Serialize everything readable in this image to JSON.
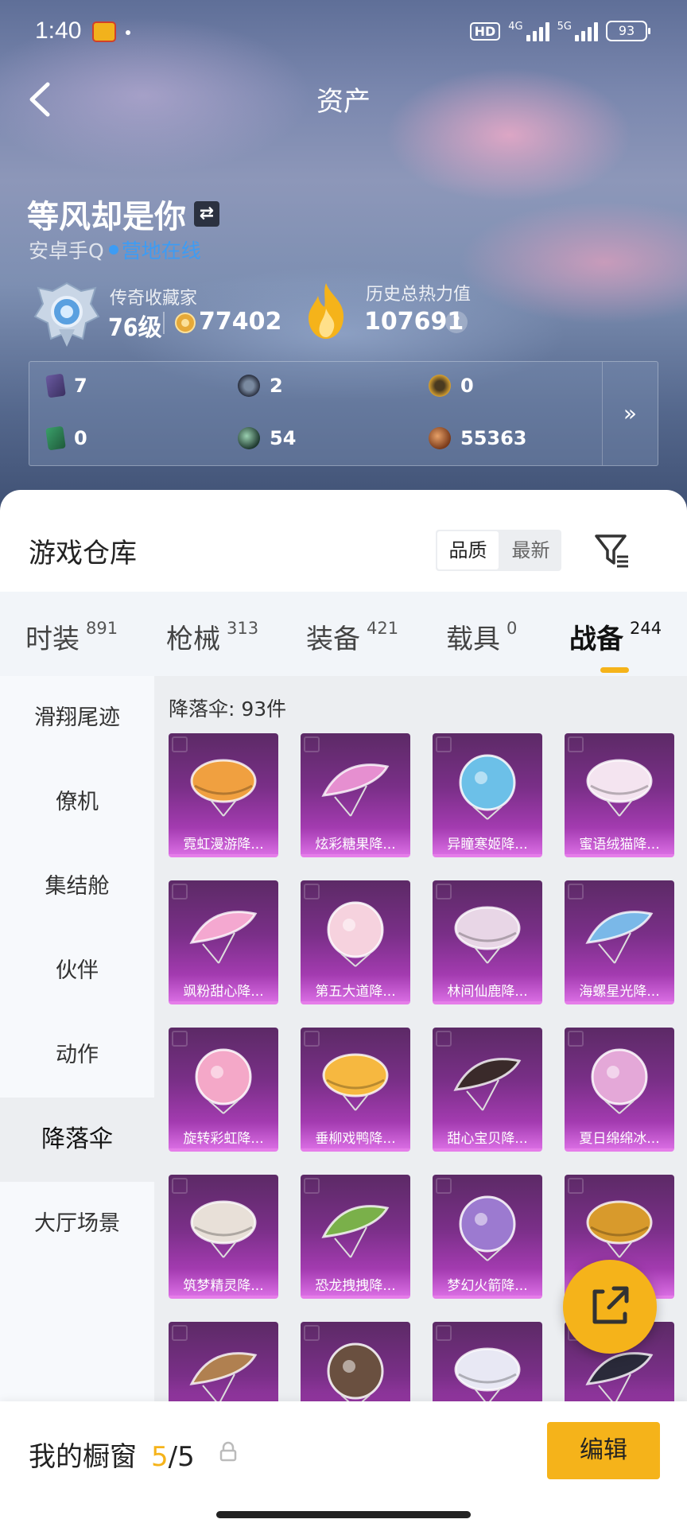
{
  "status_bar": {
    "time": "1:40",
    "hd_label": "HD",
    "net1": "4G",
    "net2": "5G",
    "battery": "93"
  },
  "header": {
    "title": "资产"
  },
  "profile": {
    "username": "等风却是你",
    "account_type": "安卓手Q",
    "online_status": "营地在线",
    "rank_title": "传奇收藏家",
    "level": "76级",
    "coins": "77402",
    "heat_title": "历史总热力值",
    "heat_value": "107691"
  },
  "stats": [
    {
      "icon": "card-icon",
      "value": "7"
    },
    {
      "icon": "round-token-icon",
      "value": "2"
    },
    {
      "icon": "gold-token-icon",
      "value": "0"
    },
    {
      "icon": "green-card-icon",
      "value": "0"
    },
    {
      "icon": "orb-icon",
      "value": "54"
    },
    {
      "icon": "bronze-coin-icon",
      "value": "55363"
    }
  ],
  "warehouse": {
    "title": "游戏仓库",
    "sort_options": [
      "品质",
      "最新"
    ],
    "active_sort": "品质"
  },
  "tabs": [
    {
      "label": "时装",
      "count": "891"
    },
    {
      "label": "枪械",
      "count": "313"
    },
    {
      "label": "装备",
      "count": "421"
    },
    {
      "label": "载具",
      "count": "0"
    },
    {
      "label": "战备",
      "count": "244"
    }
  ],
  "sidebar": {
    "items": [
      "滑翔尾迹",
      "僚机",
      "集结舱",
      "伙伴",
      "动作",
      "降落伞",
      "大厅场景"
    ],
    "active": "降落伞"
  },
  "content": {
    "header": "降落伞: 93件",
    "items": [
      "霓虹漫游降落伞",
      "炫彩糖果降落伞",
      "异瞳寒姬降落伞",
      "蜜语绒猫降落伞",
      "飒粉甜心降落伞",
      "第五大道降落伞",
      "林间仙鹿降落伞",
      "海螺星光降落伞",
      "旋转彩虹降落伞",
      "垂柳戏鸭降落伞",
      "甜心宝贝降落伞",
      "夏日绵绵冰降落伞",
      "筑梦精灵降落伞",
      "恐龙拽拽降落伞",
      "梦幻火箭降落伞",
      "",
      "",
      "",
      "",
      ""
    ],
    "item_labels_shown": [
      "霓虹漫游降...",
      "炫彩糖果降...",
      "异瞳寒姬降...",
      "蜜语绒猫降...",
      "飒粉甜心降...",
      "第五大道降...",
      "林间仙鹿降...",
      "海螺星光降...",
      "旋转彩虹降...",
      "垂柳戏鸭降...",
      "甜心宝贝降...",
      "夏日绵绵冰...",
      "筑梦精灵降...",
      "恐龙拽拽降...",
      "梦幻火箭降...",
      "",
      "",
      "",
      "",
      ""
    ],
    "art_colors": [
      "#f0a040",
      "#e68fd0",
      "#6cc0e8",
      "#f4e4f0",
      "#f4a8d0",
      "#f6d2de",
      "#e8d6e6",
      "#7ab8e8",
      "#f4a8c8",
      "#f6b840",
      "#3a2a2a",
      "#e4a8d8",
      "#e8e0d8",
      "#7ab04a",
      "#9c7ad0",
      "#d89a2c",
      "#b08050",
      "#6a5040",
      "#e8e8f4",
      "#2a2a3a"
    ]
  },
  "showcase": {
    "label": "我的橱窗",
    "current": "5",
    "total": "/5",
    "edit_label": "编辑"
  }
}
